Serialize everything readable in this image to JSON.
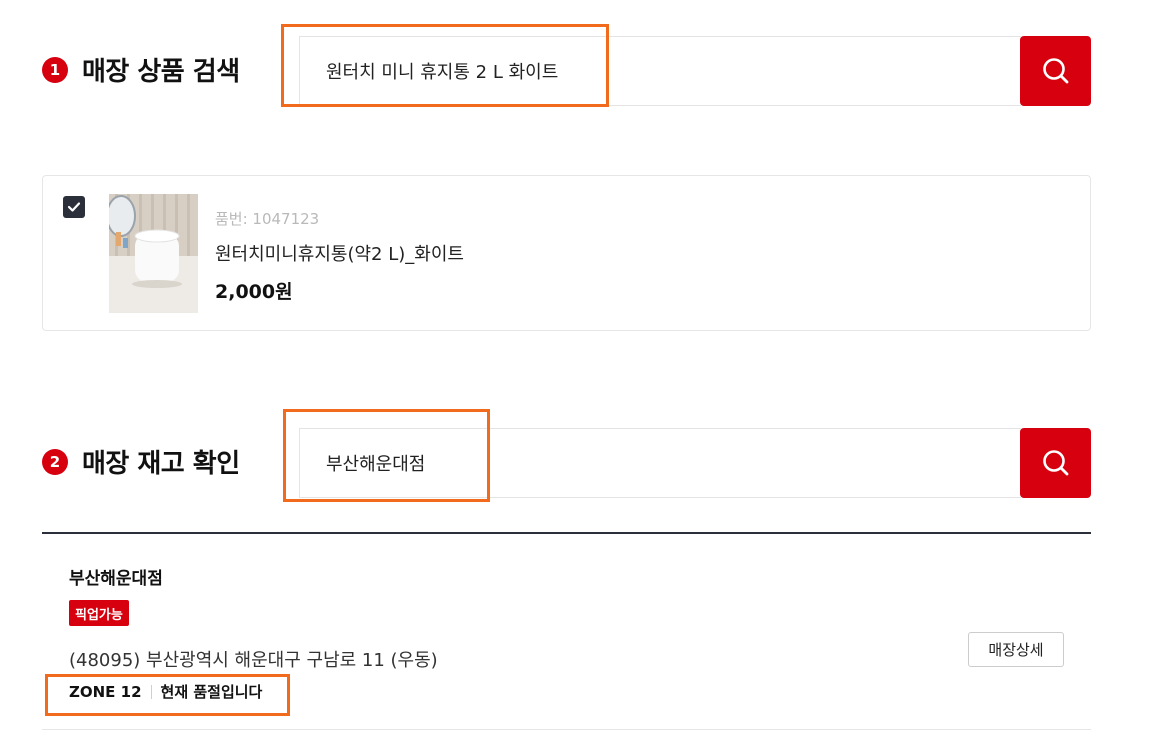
{
  "section1": {
    "number": "1",
    "title": "매장 상품 검색",
    "search_value": "원터치 미니 휴지통 2 L 화이트",
    "search_icon": "search-icon"
  },
  "product": {
    "checked": true,
    "code": "품번: 1047123",
    "name": "원터치미니휴지통(약2 L)_화이트",
    "price": "2,000원"
  },
  "section2": {
    "number": "2",
    "title": "매장 재고 확인",
    "search_value": "부산해운대점",
    "search_icon": "search-icon"
  },
  "store": {
    "name": "부산해운대점",
    "badge": "픽업가능",
    "address": "(48095) 부산광역시 해운대구 구남로 11 (우동)",
    "zone": "ZONE 12",
    "stock_status": "현재 품절입니다",
    "detail_button": "매장상세"
  },
  "colors": {
    "accent": "#d7000f",
    "highlight": "#f26a1b",
    "dark": "#2b2f3a"
  }
}
